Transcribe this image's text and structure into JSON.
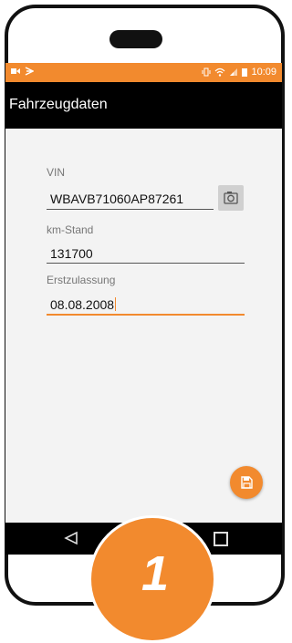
{
  "status_bar": {
    "time": "10:09"
  },
  "toolbar": {
    "title": "Fahrzeugdaten"
  },
  "form": {
    "vin": {
      "label": "VIN",
      "value": "WBAVB71060AP87261"
    },
    "km": {
      "label": "km-Stand",
      "value": "131700"
    },
    "erstzulassung": {
      "label": "Erstzulassung",
      "value": "08.08.2008"
    }
  },
  "badge": {
    "number": "1"
  },
  "colors": {
    "accent": "#f28a2e",
    "toolbar": "#000000",
    "content_bg": "#f3f3f3"
  },
  "icons": [
    "camera-icon",
    "save-icon",
    "back-icon",
    "recent-apps-icon",
    "wifi-icon",
    "signal-icon",
    "battery-icon",
    "vibrate-icon"
  ]
}
